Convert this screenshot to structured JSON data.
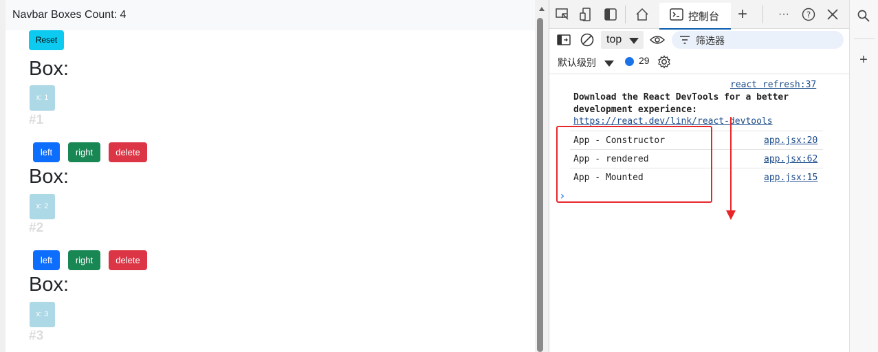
{
  "app": {
    "navbar_title": "Navbar Boxes Count: 4",
    "reset_label": "Reset",
    "boxes": [
      {
        "title": "Box:",
        "chip": "x: 1",
        "number": "#1"
      },
      {
        "title": "Box:",
        "chip": "x: 2",
        "number": "#2",
        "buttons": [
          "left",
          "right",
          "delete"
        ]
      },
      {
        "title": "Box:",
        "chip": "x: 3",
        "number": "#3",
        "buttons": [
          "left",
          "right",
          "delete"
        ]
      }
    ],
    "row_buttons": {
      "left": "left",
      "right": "right",
      "delete": "delete"
    }
  },
  "devtools": {
    "console_tab_label": "控制台",
    "context_select": "top",
    "filter_placeholder": "筛选器",
    "levels_label": "默认级别",
    "message_count": "29",
    "messages": [
      {
        "source": "react refresh:37"
      },
      {
        "text": "Download the React DevTools for a better development experience:",
        "link": "https://react.dev/link/react-devtools"
      },
      {
        "text": "App - Constructor",
        "source": "app.jsx:20"
      },
      {
        "text": "App - rendered",
        "source": "app.jsx:62"
      },
      {
        "text": "App - Mounted",
        "source": "app.jsx:15"
      }
    ],
    "prompt_symbol": "›"
  },
  "colors": {
    "reset_btn": "#0dcaf0",
    "left_btn": "#0d6efd",
    "right_btn": "#198754",
    "delete_btn": "#dc3545",
    "chip": "#add8e6",
    "annotation": "#e8262a",
    "link": "#1a4a8a"
  },
  "icons": [
    "inspect-icon",
    "device-icon",
    "dock-icon",
    "home-icon",
    "console-icon",
    "plus-icon",
    "more-icon",
    "help-icon",
    "close-icon",
    "sidebar-icon",
    "clear-icon",
    "eye-icon",
    "filter-icon",
    "gear-icon",
    "search-icon"
  ]
}
